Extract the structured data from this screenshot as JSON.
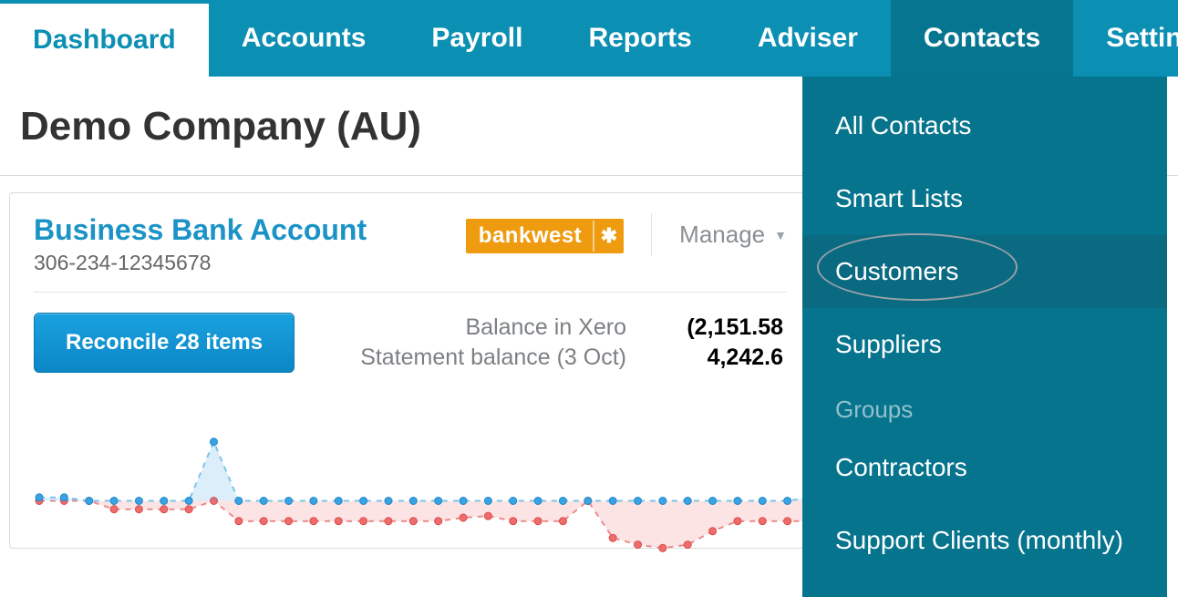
{
  "nav": {
    "tabs": [
      {
        "label": "Dashboard",
        "active": true
      },
      {
        "label": "Accounts"
      },
      {
        "label": "Payroll"
      },
      {
        "label": "Reports"
      },
      {
        "label": "Adviser"
      },
      {
        "label": "Contacts",
        "open": true
      },
      {
        "label": "Settings"
      }
    ]
  },
  "contacts_dropdown": {
    "items": [
      {
        "label": "All Contacts"
      },
      {
        "label": "Smart Lists"
      },
      {
        "label": "Customers",
        "highlighted": true
      },
      {
        "label": "Suppliers"
      }
    ],
    "group_section_label": "Groups",
    "group_items": [
      {
        "label": "Contractors"
      },
      {
        "label": "Support Clients (monthly)"
      }
    ]
  },
  "page": {
    "title": "Demo Company (AU)"
  },
  "account_card": {
    "account_name": "Business Bank Account",
    "account_number": "306-234-12345678",
    "bank_logo_text": "bankwest",
    "manage_label": "Manage",
    "reconcile_button_label": "Reconcile 28 items",
    "balances": {
      "xero_label": "Balance in Xero",
      "xero_value": "(2,151.58",
      "statement_label": "Statement balance (3 Oct)",
      "statement_value": "4,242.6"
    }
  },
  "chart_data": {
    "type": "line",
    "title": "",
    "xlabel": "",
    "ylabel": "",
    "ylim": [
      -3000,
      5000
    ],
    "series": [
      {
        "name": "Balance in Xero",
        "color": "#3aa3e3",
        "values": [
          200,
          200,
          0,
          0,
          0,
          0,
          0,
          3500,
          0,
          0,
          0,
          0,
          0,
          0,
          0,
          0,
          0,
          0,
          0,
          0,
          0,
          0,
          0,
          0,
          0,
          0,
          0,
          0,
          0,
          0,
          0,
          200
        ]
      },
      {
        "name": "Statement balance",
        "color": "#f06c6c",
        "values": [
          0,
          0,
          0,
          -500,
          -500,
          -500,
          -500,
          0,
          -1200,
          -1200,
          -1200,
          -1200,
          -1200,
          -1200,
          -1200,
          -1200,
          -1200,
          -1000,
          -900,
          -1200,
          -1200,
          -1200,
          0,
          -2200,
          -2600,
          -2800,
          -2600,
          -1800,
          -1200,
          -1200,
          -1200,
          -1200
        ]
      }
    ]
  },
  "colors": {
    "nav_bg": "#0b8fb3",
    "nav_open_bg": "#067690",
    "dropdown_bg": "#07748e",
    "accent_blue": "#1b93c6",
    "reconcile_btn": "#0b87c4",
    "bank_logo_bg": "#ef9b0f",
    "series_red": "#f06c6c",
    "series_blue": "#3aa3e3"
  }
}
